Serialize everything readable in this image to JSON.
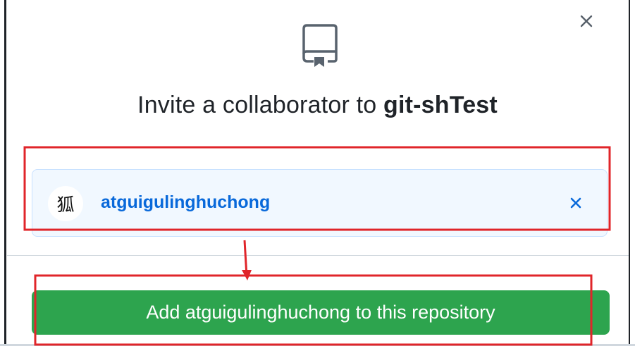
{
  "dialog": {
    "title_prefix": "Invite a collaborator to ",
    "repo_name": "git-shTest",
    "close_glyph": "×",
    "icons": {
      "close": "close-icon",
      "repo": "repo-icon",
      "remove": "remove-user-icon"
    }
  },
  "selected_user": {
    "avatar_text": "狐",
    "username": "atguigulinghuchong",
    "remove_glyph": "×"
  },
  "action": {
    "add_button_label": "Add atguigulinghuchong to this repository"
  },
  "colors": {
    "accent_link": "#0969da",
    "button_green": "#2da44e",
    "annotation_red": "#e0252a",
    "selected_bg": "#f1f8ff"
  }
}
